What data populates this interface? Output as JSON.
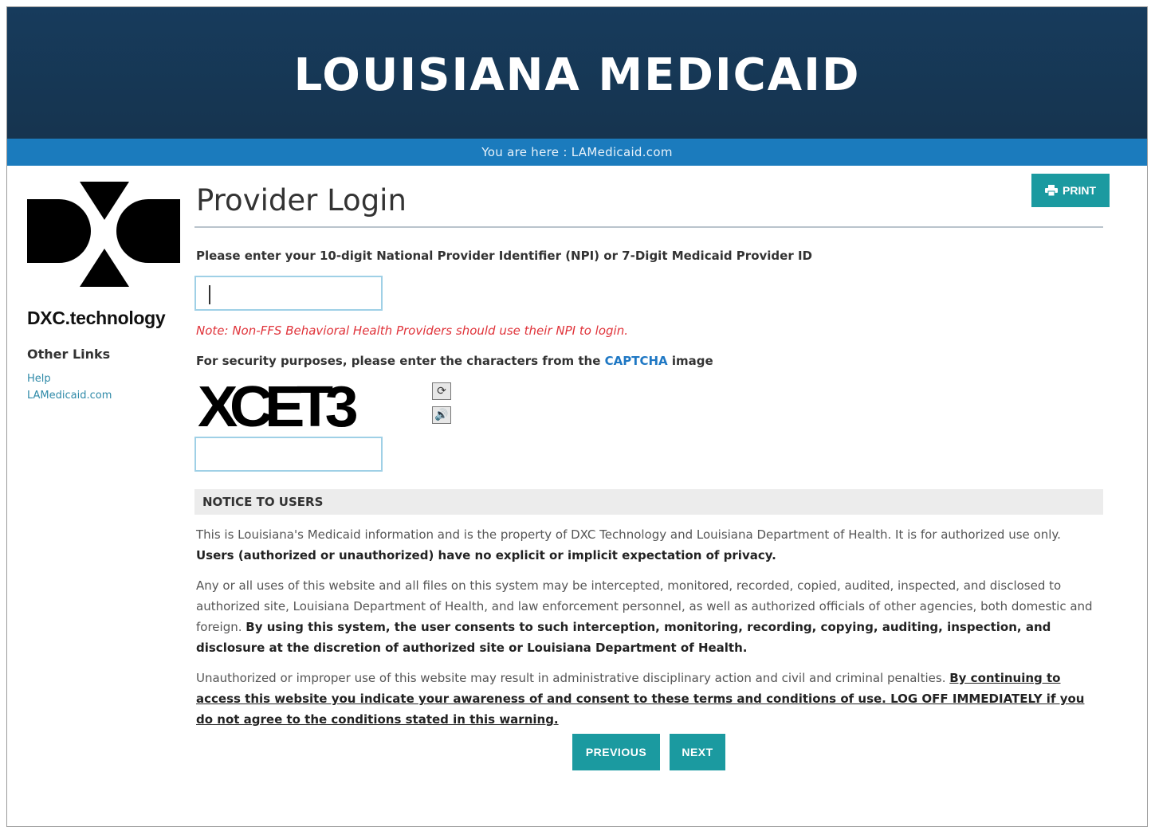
{
  "header": {
    "title": "LOUISIANA MEDICAID"
  },
  "breadcrumb": {
    "text": "You are here : LAMedicaid.com"
  },
  "sidebar": {
    "logo_text": "DXC.technology",
    "other_links_heading": "Other Links",
    "links": [
      {
        "label": "Help"
      },
      {
        "label": "LAMedicaid.com"
      }
    ]
  },
  "main": {
    "title": "Provider Login",
    "print_label": "PRINT",
    "npi_label": "Please enter your 10-digit National Provider Identifier (NPI) or 7-Digit Medicaid Provider ID",
    "npi_value": "",
    "note": "Note: Non-FFS Behavioral Health Providers should use their NPI to login.",
    "captcha_label_before": "For security purposes, please enter the characters from the",
    "captcha_link": "CAPTCHA",
    "captcha_label_after": "image",
    "captcha_text": "XCET3",
    "captcha_value": ""
  },
  "notice": {
    "heading": "NOTICE TO USERS",
    "p1_normal": "This is Louisiana's Medicaid information and is the property of DXC Technology and Louisiana Department of Health. It is for authorized use only.",
    "p1_bold": "Users (authorized or unauthorized) have no explicit or implicit expectation of privacy.",
    "p2_normal": "Any or all uses of this website and all files on this system may be intercepted, monitored, recorded, copied, audited, inspected, and disclosed to authorized site, Louisiana Department of Health, and law enforcement personnel, as well as authorized officials of other agencies, both domestic and foreign.",
    "p2_bold": "By using this system, the user consents to such interception, monitoring, recording, copying, auditing, inspection, and disclosure at the discretion of authorized site or Louisiana Department of Health.",
    "p3_normal": "Unauthorized or improper use of this website may result in administrative disciplinary action and civil and criminal penalties.",
    "p3_underlined": "By continuing to access this website you indicate your awareness of and consent to these terms and conditions of use. LOG OFF IMMEDIATELY if you do not agree to the conditions stated in this warning."
  },
  "buttons": {
    "previous": "PREVIOUS",
    "next": "NEXT"
  },
  "colors": {
    "header_bg": "#173a5a",
    "breadcrumb_bg": "#1b7bbd",
    "button_teal": "#1b9aa0",
    "note_red": "#e0333a",
    "link_blue": "#1f78c4"
  }
}
